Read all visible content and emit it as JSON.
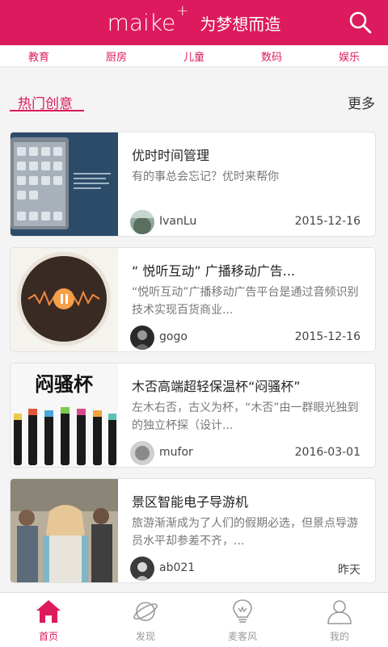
{
  "header": {
    "logo": "maike",
    "logo_sup": "+",
    "slogan": "为梦想而造"
  },
  "categories": [
    "教育",
    "厨房",
    "儿童",
    "数码",
    "娱乐"
  ],
  "section": {
    "title": "热门创意",
    "more": "更多"
  },
  "cards": [
    {
      "title": "优时时间管理",
      "desc": "有的事总会忘记？优时来帮你",
      "author": "IvanLu",
      "date": "2015-12-16"
    },
    {
      "title": "“ 悦听互动” 广播移动广告...",
      "desc": "“悦听互动”广播移动广告平台是通过音频识别技术实现百货商业...",
      "author": "gogo",
      "date": "2015-12-16"
    },
    {
      "title": "木否高端超轻保温杯“闷骚杯”",
      "desc": "左木右否，古义为杯，“木否”由一群眼光独到的独立杯探（设计...",
      "author": "mufor",
      "date": "2016-03-01"
    },
    {
      "title": "景区智能电子导游机",
      "desc": "旅游渐渐成为了人们的假期必选，但景点导游员水平却参差不齐，...",
      "author": "ab021",
      "date": "昨天"
    }
  ],
  "tabs": [
    "首页",
    "发现",
    "麦客风",
    "我的"
  ],
  "thumb_text": {
    "cup_title": "闷骚杯"
  },
  "colors": {
    "brand": "#dd1a5e"
  }
}
